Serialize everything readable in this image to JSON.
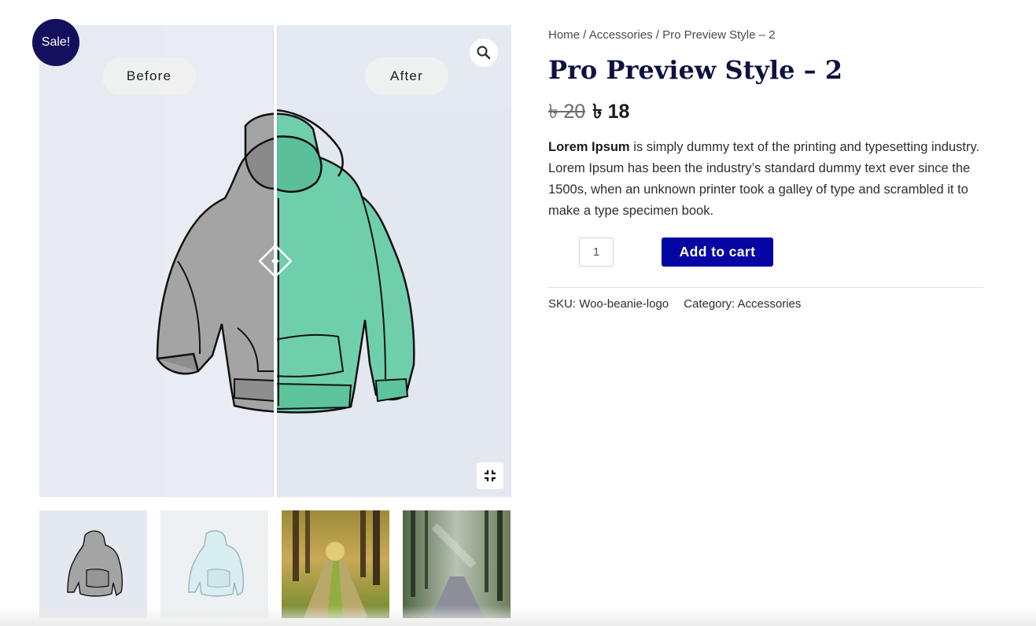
{
  "badge": {
    "sale": "Sale!"
  },
  "compare": {
    "before_label": "Before",
    "after_label": "After"
  },
  "icons": {
    "zoom": "search-icon",
    "fullscreen": "exit-fullscreen-icon",
    "slider": "compare-slider-handle-icon"
  },
  "thumbnails": [
    {
      "name": "grey-hoodie-thumbnail"
    },
    {
      "name": "light-hoodie-thumbnail"
    },
    {
      "name": "forest-path-thumbnail"
    },
    {
      "name": "misty-forest-road-thumbnail"
    }
  ],
  "breadcrumb": {
    "home": "Home",
    "sep1": " / ",
    "category": "Accessories",
    "sep2": " / ",
    "current": "Pro Preview Style – 2"
  },
  "product": {
    "title": "Pro Preview Style – 2",
    "regular_price": "৳ 20",
    "sale_price": "৳ 18",
    "description_bold": "Lorem Ipsum",
    "description_rest": " is simply dummy text of the printing and typesetting industry. Lorem Ipsum has been the industry’s standard dummy text ever since the 1500s, when an unknown printer took a galley of type and scrambled it to make a type specimen book.",
    "quantity": "1",
    "add_to_cart": "Add to cart",
    "sku_label": "SKU: ",
    "sku_value": "Woo-beanie-logo",
    "category_label": "Category: ",
    "category_value": "Accessories"
  },
  "colors": {
    "accent": "#0405a2",
    "badge": "#14105e",
    "title": "#0d1140",
    "after_hoodie": "#6fcfac",
    "before_hoodie": "#a4a4a4"
  }
}
